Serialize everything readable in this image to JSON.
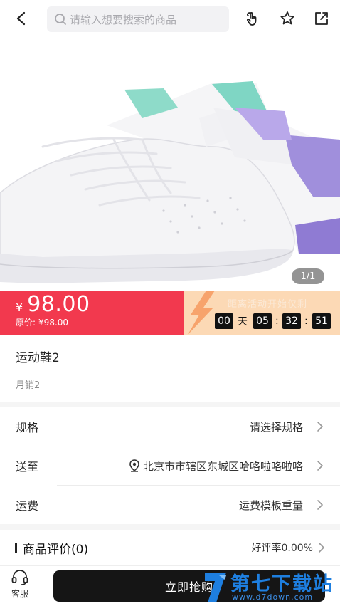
{
  "search": {
    "placeholder": "请输入想要搜索的商品"
  },
  "product_image": {
    "pager": "1/1"
  },
  "promo": {
    "currency": "¥",
    "price": "98.00",
    "original_label": "原价:",
    "original_price": "¥98.00",
    "countdown_label": "距离活动开始仅剩",
    "days": "00",
    "days_unit": "天",
    "hours": "05",
    "minutes": "32",
    "seconds": "51",
    "colors": {
      "price_bg": "#f2394e",
      "countdown_bg": "#fcd9b5"
    }
  },
  "product": {
    "title": "运动鞋2",
    "monthly_sales": "月销2"
  },
  "rows": {
    "spec": {
      "label": "规格",
      "value": "请选择规格"
    },
    "ship_to": {
      "label": "送至",
      "value": "北京市市辖区东城区哈咯啦咯啦咯"
    },
    "freight": {
      "label": "运费",
      "value": "运费模板重量"
    }
  },
  "reviews": {
    "title": "商品评价(0)",
    "rate": "好评率0.00%"
  },
  "bottom": {
    "service_label": "客服",
    "buy_label": "立即抢购"
  },
  "watermark": {
    "title": "第七下载站",
    "url": "www.d7down.com"
  }
}
